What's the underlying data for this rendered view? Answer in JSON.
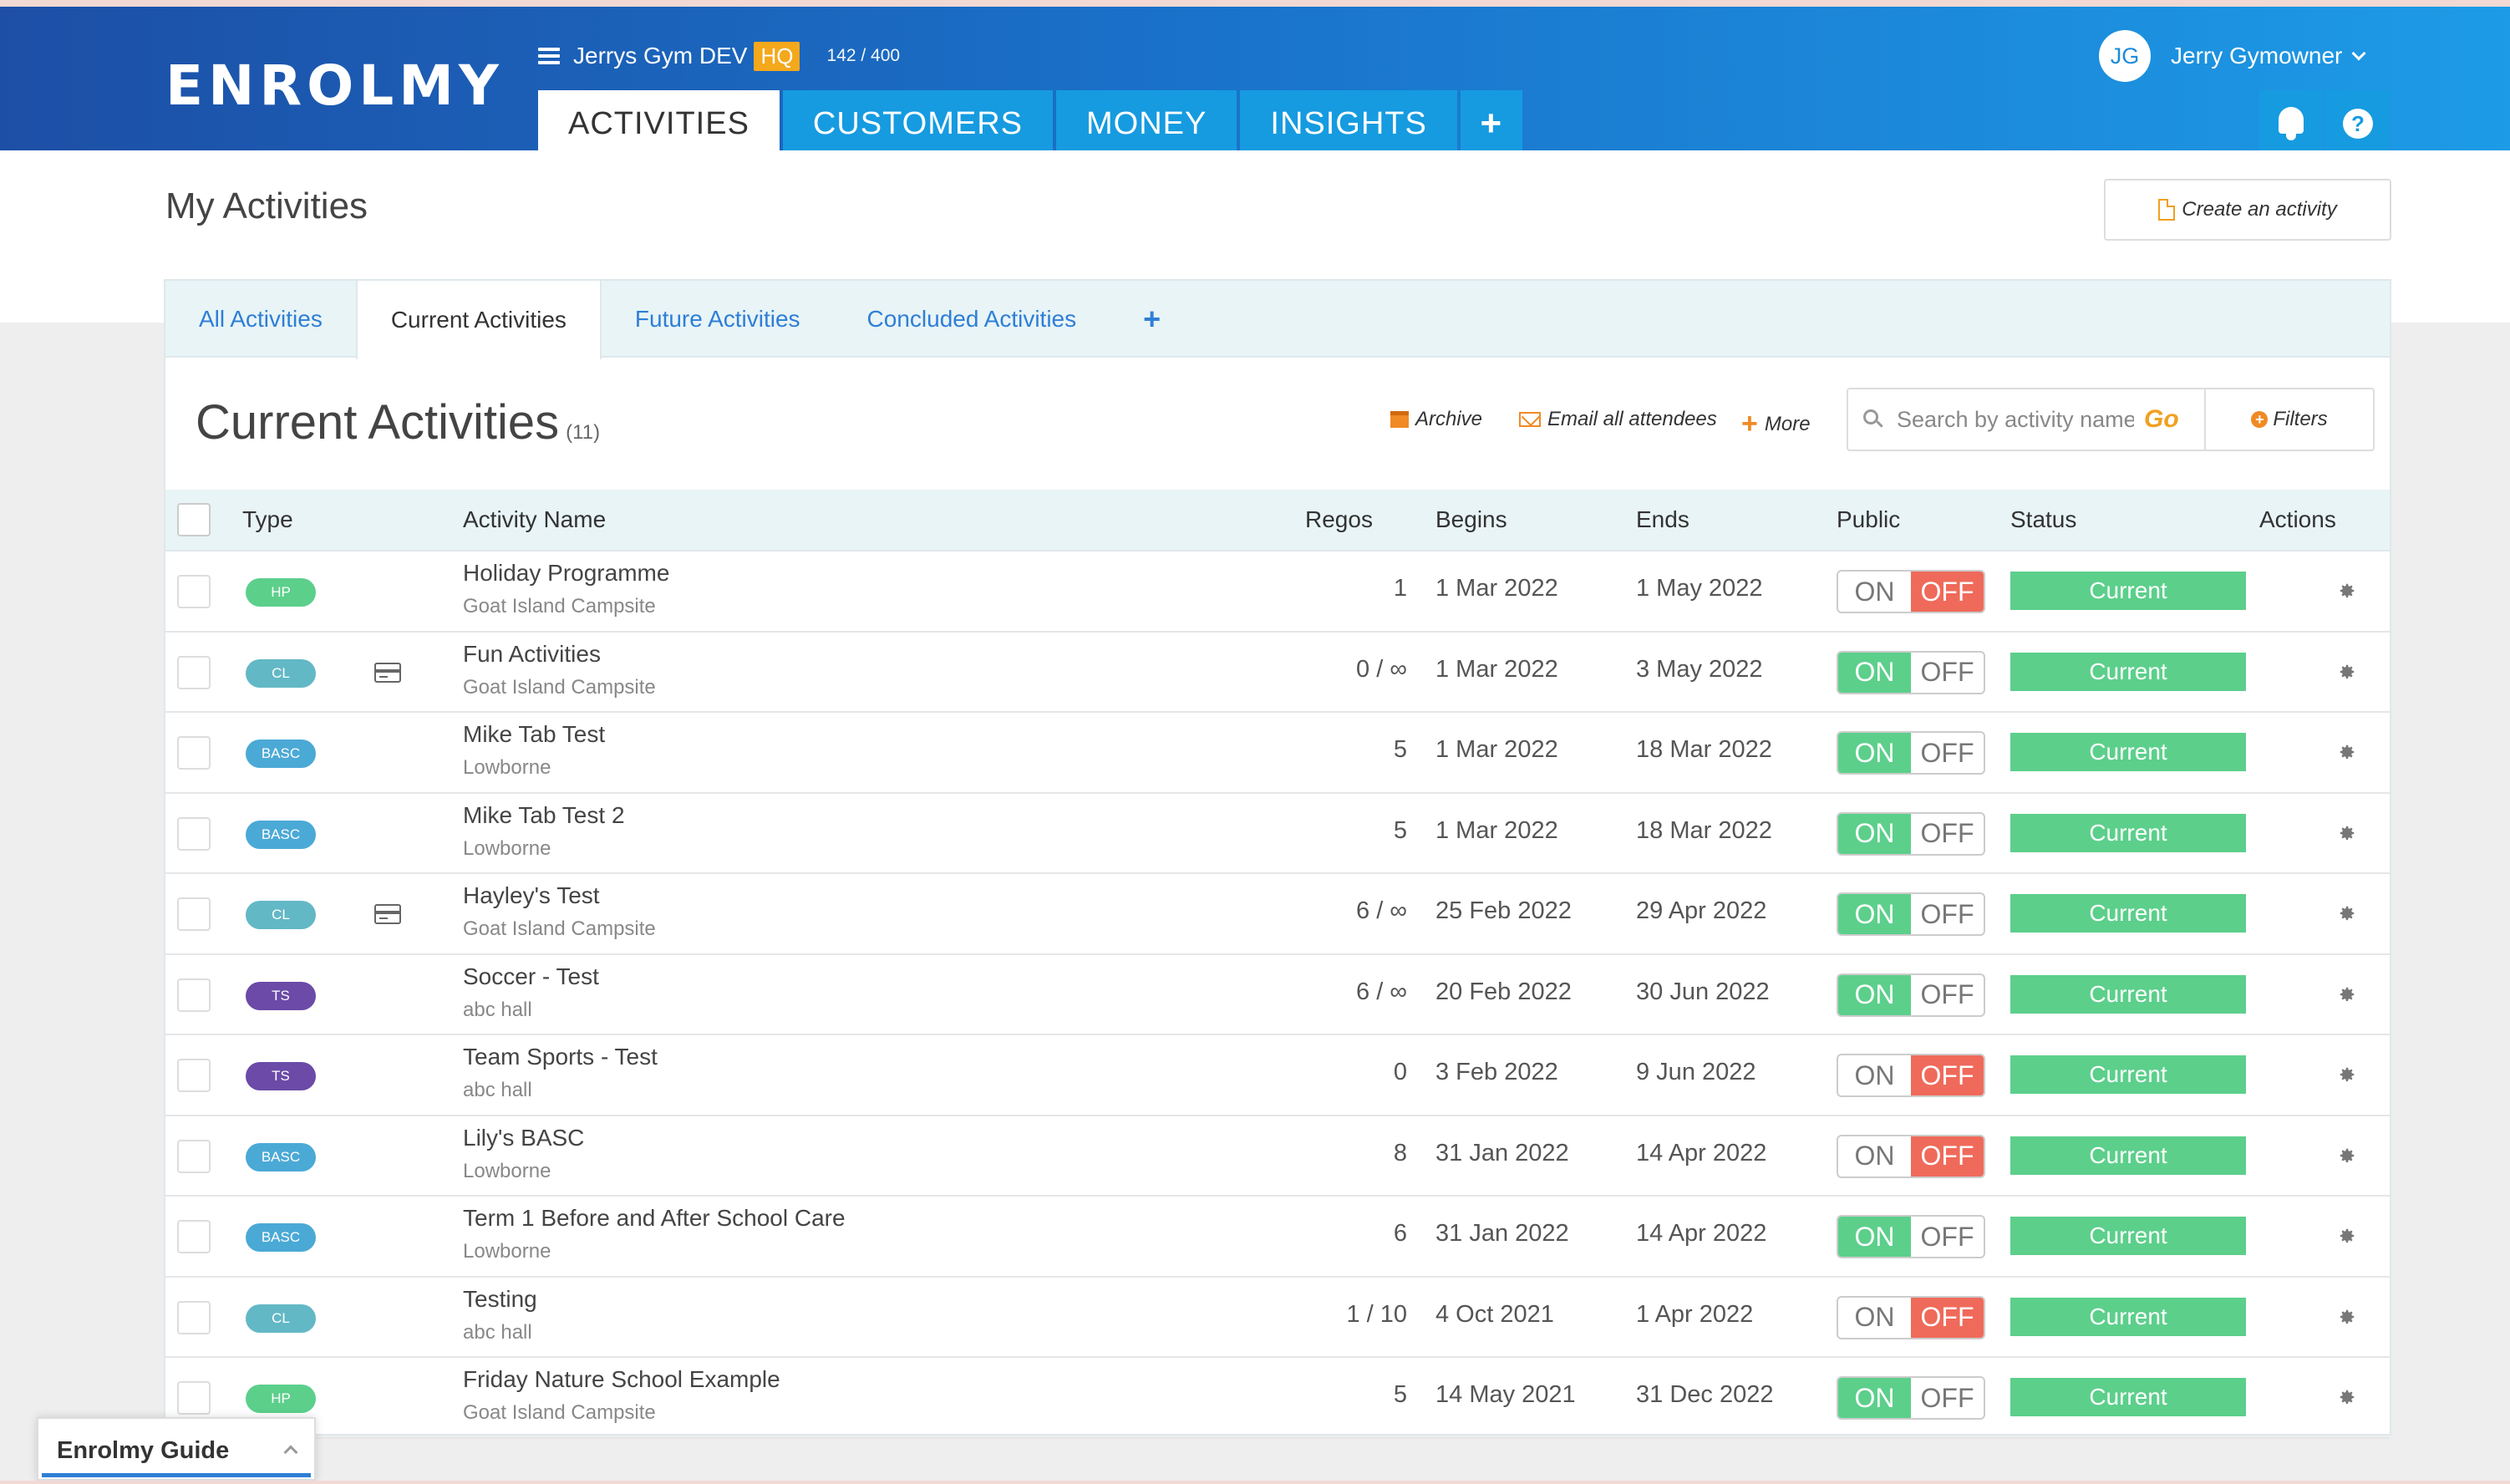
{
  "header": {
    "logo": "ENROLMY",
    "org_name": "Jerrys Gym DEV",
    "hq_badge": "HQ",
    "count": "142 / 400",
    "nav_tabs": [
      {
        "label": "ACTIVITIES",
        "active": true
      },
      {
        "label": "CUSTOMERS",
        "active": false
      },
      {
        "label": "MONEY",
        "active": false
      },
      {
        "label": "INSIGHTS",
        "active": false
      }
    ],
    "nav_plus": "+",
    "user": {
      "initials": "JG",
      "name": "Jerry Gymowner"
    },
    "help_icon": "?"
  },
  "page": {
    "title": "My Activities",
    "create_button": "Create an activity"
  },
  "subtabs": {
    "items": [
      "All Activities",
      "Current Activities",
      "Future Activities",
      "Concluded Activities"
    ],
    "active_index": 1,
    "plus": "+"
  },
  "section": {
    "title": "Current Activities",
    "count": "(11)",
    "tools": {
      "archive": "Archive",
      "email": "Email all attendees",
      "more": "More"
    },
    "search_placeholder": "Search by activity name",
    "go": "Go",
    "filters": "Filters"
  },
  "table": {
    "headers": {
      "type": "Type",
      "name": "Activity Name",
      "regos": "Regos",
      "begins": "Begins",
      "ends": "Ends",
      "public": "Public",
      "status": "Status",
      "actions": "Actions"
    },
    "toggle_labels": {
      "on": "ON",
      "off": "OFF"
    },
    "rows": [
      {
        "type": "HP",
        "card": false,
        "name": "Holiday Programme",
        "venue": "Goat Island Campsite",
        "regos": "1",
        "begins": "1 Mar 2022",
        "ends": "1 May 2022",
        "public": false,
        "status": "Current"
      },
      {
        "type": "CL",
        "card": true,
        "name": "Fun Activities",
        "venue": "Goat Island Campsite",
        "regos": "0 / ∞",
        "begins": "1 Mar 2022",
        "ends": "3 May 2022",
        "public": true,
        "status": "Current"
      },
      {
        "type": "BASC",
        "card": false,
        "name": "Mike Tab Test",
        "venue": "Lowborne",
        "regos": "5",
        "begins": "1 Mar 2022",
        "ends": "18 Mar 2022",
        "public": true,
        "status": "Current"
      },
      {
        "type": "BASC",
        "card": false,
        "name": "Mike Tab Test 2",
        "venue": "Lowborne",
        "regos": "5",
        "begins": "1 Mar 2022",
        "ends": "18 Mar 2022",
        "public": true,
        "status": "Current"
      },
      {
        "type": "CL",
        "card": true,
        "name": "Hayley's Test",
        "venue": "Goat Island Campsite",
        "regos": "6 / ∞",
        "begins": "25 Feb 2022",
        "ends": "29 Apr 2022",
        "public": true,
        "status": "Current"
      },
      {
        "type": "TS",
        "card": false,
        "name": "Soccer - Test",
        "venue": "abc hall",
        "regos": "6 / ∞",
        "begins": "20 Feb 2022",
        "ends": "30 Jun 2022",
        "public": true,
        "status": "Current"
      },
      {
        "type": "TS",
        "card": false,
        "name": "Team Sports - Test",
        "venue": "abc hall",
        "regos": "0",
        "begins": "3 Feb 2022",
        "ends": "9 Jun 2022",
        "public": false,
        "status": "Current"
      },
      {
        "type": "BASC",
        "card": false,
        "name": "Lily's BASC",
        "venue": "Lowborne",
        "regos": "8",
        "begins": "31 Jan 2022",
        "ends": "14 Apr 2022",
        "public": false,
        "status": "Current"
      },
      {
        "type": "BASC",
        "card": false,
        "name": "Term 1 Before and After School Care",
        "venue": "Lowborne",
        "regos": "6",
        "begins": "31 Jan 2022",
        "ends": "14 Apr 2022",
        "public": true,
        "status": "Current"
      },
      {
        "type": "CL",
        "card": false,
        "name": "Testing",
        "venue": "abc hall",
        "regos": "1 / 10",
        "begins": "4 Oct 2021",
        "ends": "1 Apr 2022",
        "public": false,
        "status": "Current"
      },
      {
        "type": "HP",
        "card": false,
        "name": "Friday Nature School Example",
        "venue": "Goat Island Campsite",
        "regos": "5",
        "begins": "14 May 2021",
        "ends": "31 Dec 2022",
        "public": true,
        "status": "Current"
      }
    ]
  },
  "type_colors": {
    "HP": "#5ccf8b",
    "CL": "#63b8c6",
    "BASC": "#4ba9d6",
    "TS": "#6b4aa8"
  },
  "guide": {
    "label": "Enrolmy Guide"
  },
  "icons": {
    "menu": "hamburger-icon",
    "bell": "bell-icon",
    "help": "help-icon",
    "create": "document-icon",
    "archive": "archive-icon",
    "email": "envelope-icon",
    "more": "plus-icon",
    "search": "search-icon",
    "filters": "plus-circle-icon",
    "card": "credit-card-icon",
    "actions": "gear-icon"
  }
}
